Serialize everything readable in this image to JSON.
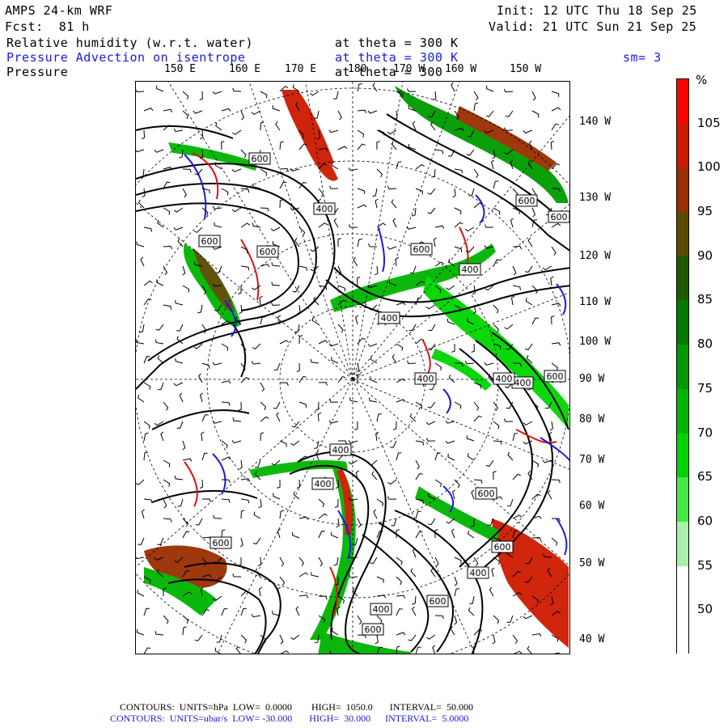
{
  "header": {
    "model": "AMPS 24-km WRF",
    "init": "Init: 12 UTC Thu 18 Sep 25",
    "fcst": "Fcst:  81 h",
    "valid": "Valid: 21 UTC Sun 21 Sep 25",
    "field1": "Relative humidity (w.r.t. water)",
    "field1_level": "at theta = 300 K",
    "field2": "Pressure Advection on isentrope",
    "field2_level": "at theta = 300 K",
    "smoothing": "sm= 3",
    "field3": "Pressure",
    "field3_level": "at theta = 300"
  },
  "lon_top": [
    "150 E",
    "160 E",
    "170 E",
    "180",
    "170 W",
    "160 W",
    "150 W"
  ],
  "lon_right": [
    "140 W",
    "130 W",
    "120 W",
    "110 W",
    "100 W",
    "90 W",
    "80 W",
    "70 W",
    "60 W",
    "50 W",
    "40 W"
  ],
  "colorbar": {
    "unit": "%",
    "labels": [
      "105",
      "100",
      "95",
      "90",
      "85",
      "80",
      "75",
      "70",
      "65",
      "60",
      "55",
      "50"
    ],
    "colors": [
      "#ff0000",
      "#cc1a00",
      "#9a2e00",
      "#5a4a00",
      "#1e5a00",
      "#007a00",
      "#009a00",
      "#00b400",
      "#00d400",
      "#44e844",
      "#a8f0a8",
      "#ffffff",
      "#ffffff"
    ]
  },
  "contour_labels": [
    "600",
    "600",
    "600",
    "400",
    "400",
    "400",
    "400",
    "400",
    "400",
    "400",
    "400",
    "400",
    "400",
    "600",
    "600",
    "600",
    "600",
    "600",
    "600",
    "600",
    "600",
    "600"
  ],
  "footer": {
    "line1": "CONTOURS:  UNITS=hPa  LOW=  0.0000        HIGH=  1050.0       INTERVAL=  50.000",
    "line2": "CONTOURS:  UNITS=ubar/s  LOW= -30.000       HIGH=  30.000      INTERVAL=  5.0000"
  },
  "colors": {
    "advection_line": "#1a1ae0",
    "positive_advection": "#e01010",
    "pressure_contour": "#000000"
  }
}
